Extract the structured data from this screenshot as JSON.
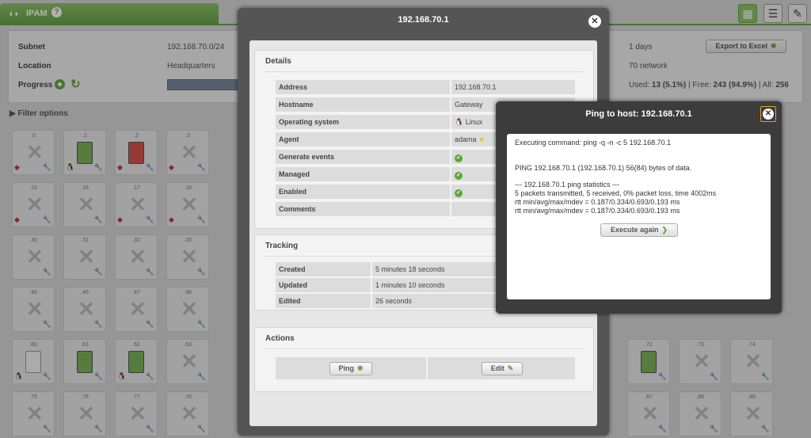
{
  "app": {
    "title": "IPAM"
  },
  "summary": {
    "subnet_label": "Subnet",
    "subnet_value": "192.168.70.0/24",
    "location_label": "Location",
    "location_value": "Headquarters",
    "progress_label": "Progress",
    "right_value1": "1 days",
    "right_value2": "70 network",
    "export_label": "Export to Excel",
    "used_label": "Used:",
    "used_value": "13 (5.1%)",
    "free_label": "| Free:",
    "free_value": "243 (94.9%)",
    "all_label": "| All:",
    "all_value": "256"
  },
  "filter_label": "Filter options",
  "grid": {
    "cells": [
      {
        "n": ".0",
        "t": "x",
        "os": "win"
      },
      {
        "n": ".1",
        "t": "green",
        "os": "linux"
      },
      {
        "n": ".2",
        "t": "red",
        "os": "win"
      },
      {
        "n": ".3",
        "t": "x",
        "os": "win"
      },
      {
        "n": ".15",
        "t": "x",
        "os": "win"
      },
      {
        "n": ".16",
        "t": "x",
        "os": ""
      },
      {
        "n": ".17",
        "t": "x",
        "os": "win"
      },
      {
        "n": ".18",
        "t": "x",
        "os": "win"
      },
      {
        "n": ".30",
        "t": "x",
        "os": ""
      },
      {
        "n": ".31",
        "t": "x",
        "os": ""
      },
      {
        "n": ".32",
        "t": "x",
        "os": ""
      },
      {
        "n": ".33",
        "t": "x",
        "os": ""
      },
      {
        "n": ".45",
        "t": "x",
        "os": ""
      },
      {
        "n": ".46",
        "t": "x",
        "os": ""
      },
      {
        "n": ".47",
        "t": "x",
        "os": ""
      },
      {
        "n": ".48",
        "t": "x",
        "os": ""
      },
      {
        "n": ".60",
        "t": "white",
        "os": "linux"
      },
      {
        "n": ".61",
        "t": "green",
        "os": ""
      },
      {
        "n": ".62",
        "t": "green",
        "os": "linux"
      },
      {
        "n": ".63",
        "t": "x",
        "os": ""
      },
      {
        "n": ".75",
        "t": "x",
        "os": ""
      },
      {
        "n": ".76",
        "t": "x",
        "os": ""
      },
      {
        "n": ".77",
        "t": "x",
        "os": ""
      },
      {
        "n": ".78",
        "t": "x",
        "os": ""
      }
    ],
    "right_cells": [
      {
        "n": ".72",
        "t": "green",
        "os": ""
      },
      {
        "n": ".73",
        "t": "x",
        "os": ""
      },
      {
        "n": ".74",
        "t": "x",
        "os": ""
      },
      {
        "n": ".87",
        "t": "x",
        "os": ""
      },
      {
        "n": ".88",
        "t": "x",
        "os": ""
      },
      {
        "n": ".89",
        "t": "x",
        "os": ""
      }
    ]
  },
  "modal": {
    "title": "192.168.70.1",
    "details": {
      "title": "Details",
      "rows": [
        {
          "k": "Address",
          "v": "192.168.70.1"
        },
        {
          "k": "Hostname",
          "v": "Gateway"
        },
        {
          "k": "Operating system",
          "v": "Linux"
        },
        {
          "k": "Agent",
          "v": "adama"
        },
        {
          "k": "Generate events",
          "v": "✔"
        },
        {
          "k": "Managed",
          "v": "✔"
        },
        {
          "k": "Enabled",
          "v": "✔"
        },
        {
          "k": "Comments",
          "v": ""
        }
      ]
    },
    "tracking": {
      "title": "Tracking",
      "rows": [
        {
          "k": "Created",
          "v": "5 minutes 18 seconds"
        },
        {
          "k": "Updated",
          "v": "1 minutes 10 seconds"
        },
        {
          "k": "Edited",
          "v": "26 seconds"
        }
      ]
    },
    "actions": {
      "title": "Actions",
      "ping_label": "Ping",
      "edit_label": "Edit"
    }
  },
  "ping": {
    "title": "Ping to host: 192.168.70.1",
    "lines": [
      "Executing command: ping -q -n -c 5 192.168.70.1",
      "PING 192.168.70.1 (192.168.70.1) 56(84) bytes of data.",
      "--- 192.168.70.1 ping statistics ---",
      "5 packets transmitted, 5 received, 0% packet loss, time 4002ms",
      "rtt min/avg/max/mdev = 0.187/0.334/0.693/0.193 ms",
      "rtt min/avg/max/mdev = 0.187/0.334/0.693/0.193 ms"
    ],
    "execute_label": "Execute again"
  },
  "colors": {
    "accent": "#6aa446",
    "modal_bg": "#555555",
    "ping_bg": "#3c3c3c"
  }
}
